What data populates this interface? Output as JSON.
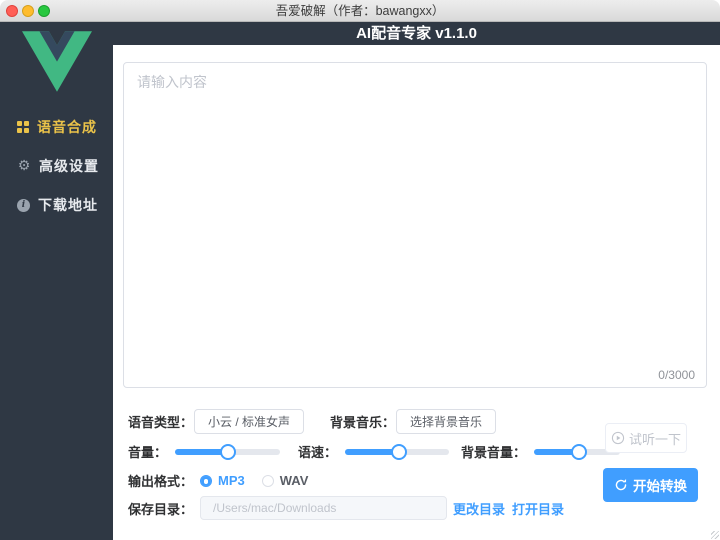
{
  "window": {
    "titlebar_text": "吾爱破解（作者：bawangxx）",
    "app_title": "AI配音专家 v1.1.0"
  },
  "sidebar": {
    "items": [
      {
        "label": "语音合成",
        "icon": "grid-icon",
        "active": true
      },
      {
        "label": "高级设置",
        "icon": "gear-icon",
        "active": false
      },
      {
        "label": "下载地址",
        "icon": "info-icon",
        "active": false
      }
    ]
  },
  "editor": {
    "placeholder": "请输入内容",
    "value": "",
    "counter": "0/3000",
    "max_chars": 3000
  },
  "controls": {
    "voice_type_label": "语音类型：",
    "voice_type_value": "小云 / 标准女声",
    "bg_music_label": "背景音乐：",
    "bg_music_button": "选择背景音乐",
    "volume_label": "音量：",
    "volume_percent": 50,
    "speed_label": "语速：",
    "speed_percent": 52,
    "bg_volume_label": "背景音量：",
    "bg_volume_percent": 52,
    "format_label": "输出格式：",
    "format_options": [
      {
        "label": "MP3",
        "selected": true
      },
      {
        "label": "WAV",
        "selected": false
      }
    ],
    "save_dir_label": "保存目录：",
    "save_dir_value": "/Users/mac/Downloads",
    "change_dir_link": "更改目录",
    "open_dir_link": "打开目录"
  },
  "actions": {
    "preview_button": "试听一下",
    "convert_button": "开始转换"
  },
  "colors": {
    "accent": "#409eff",
    "sidebar_bg": "#2f3844",
    "active_menu": "#ebc349"
  },
  "icons": {
    "gear_glyph": "⚙",
    "info_glyph": "i"
  }
}
